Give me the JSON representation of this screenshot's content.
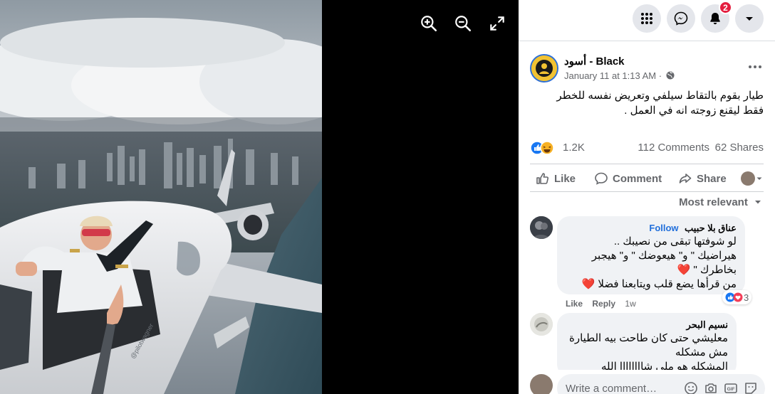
{
  "viewer": {
    "tools": [
      {
        "icon": "zoom-in-icon"
      },
      {
        "icon": "zoom-out-icon"
      },
      {
        "icon": "fullscreen-icon"
      }
    ],
    "photo_caption_watermark": "@pilotwagner"
  },
  "topbar": {
    "menu_icon": "grid-menu-icon",
    "messenger_icon": "messenger-icon",
    "notifications_icon": "bell-icon",
    "notifications_badge": "2",
    "account_icon": "caret-down-icon"
  },
  "post": {
    "page_name": "أسود - Black",
    "time": "January 11 at 1:13 AM ·",
    "text_lines": [
      "طيار بقوم بالتقاط سيلفي وتعريض نفسه للخطر",
      "فقط ليقنع زوجته انه في العمل ."
    ],
    "reactions_count": "1.2K",
    "comments_count": "112 Comments",
    "shares_count": "62 Shares",
    "actions": {
      "like": "Like",
      "comment": "Comment",
      "share": "Share"
    },
    "sort_label": "Most relevant"
  },
  "comments": [
    {
      "author": "عناق بلا حبيب",
      "follow": "Follow",
      "lines": [
        "لو شوفتها تبقى من نصيبك ..",
        "هيراضيك \" و\" هيعوضك \" و\" هيجبر",
        "بخاطرك \" ❤️",
        "من قرأها يضع قلب ويتابعنا فضلا ❤️"
      ],
      "like_label": "Like",
      "reply_label": "Reply",
      "age": "1w",
      "reaction_count": "3"
    },
    {
      "author": "نسيم البحر",
      "lines": [
        "معليشي حتى كان طاحت بيه الطيارة",
        "مش مشكله",
        "المشكله هو ملى شاااااااا الله"
      ]
    }
  ],
  "composer": {
    "placeholder": "Write a comment…",
    "icons": [
      "emoji-icon",
      "camera-icon",
      "gif-icon",
      "sticker-icon"
    ]
  },
  "colors": {
    "accent": "#216fdb",
    "badge": "#e41e3f",
    "viewer_bg": "#000000",
    "bubble": "#f0f2f5"
  }
}
